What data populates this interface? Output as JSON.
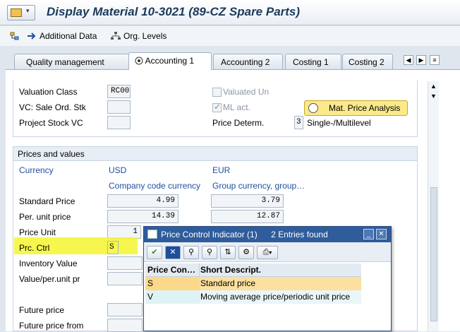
{
  "title": "Display Material 10-3021 (89-CZ Spare Parts)",
  "toolbar": {
    "additional_data": "Additional Data",
    "org_levels": "Org. Levels"
  },
  "tabs": [
    "Quality management",
    "Accounting 1",
    "Accounting 2",
    "Costing 1",
    "Costing 2"
  ],
  "top_section": {
    "valuation_class": {
      "label": "Valuation Class",
      "value": "RC00"
    },
    "vc_sale_ord_stk": {
      "label": "VC: Sale Ord. Stk",
      "value": ""
    },
    "project_stock_vc": {
      "label": "Project Stock VC",
      "value": ""
    },
    "valuated_un": {
      "label": "Valuated Un",
      "checked": false
    },
    "ml_act": {
      "label": "ML act.",
      "checked": true
    },
    "price_determ": {
      "label": "Price Determ.",
      "value": "3",
      "text": "Single-/Multilevel"
    },
    "mat_price_analysis": "Mat. Price Analysis"
  },
  "prices_section": {
    "title": "Prices and values",
    "currency_label": "Currency",
    "currency1": "USD",
    "currency1_desc": "Company code currency",
    "currency2": "EUR",
    "currency2_desc": "Group currency, group…",
    "standard_price": {
      "label": "Standard Price",
      "v1": "4.99",
      "v2": "3.79"
    },
    "per_unit_price": {
      "label": "Per. unit price",
      "v1": "14.39",
      "v2": "12.87"
    },
    "price_unit": {
      "label": "Price Unit",
      "v1": "1"
    },
    "prc_ctrl": {
      "label": "Prc. Ctrl",
      "value": "S"
    },
    "inventory_value": {
      "label": "Inventory Value"
    },
    "value_per_unit": {
      "label": "Value/per.unit pr"
    },
    "future_price": {
      "label": "Future price"
    },
    "future_price_from": {
      "label": "Future price from"
    }
  },
  "popup": {
    "title": "Price Control Indicator (1)",
    "entries": "2 Entries found",
    "columns": [
      "Price Con…",
      "Short Descript."
    ],
    "rows": [
      {
        "code": "S",
        "desc": "Standard price"
      },
      {
        "code": "V",
        "desc": "Moving average price/periodic unit price"
      }
    ]
  }
}
